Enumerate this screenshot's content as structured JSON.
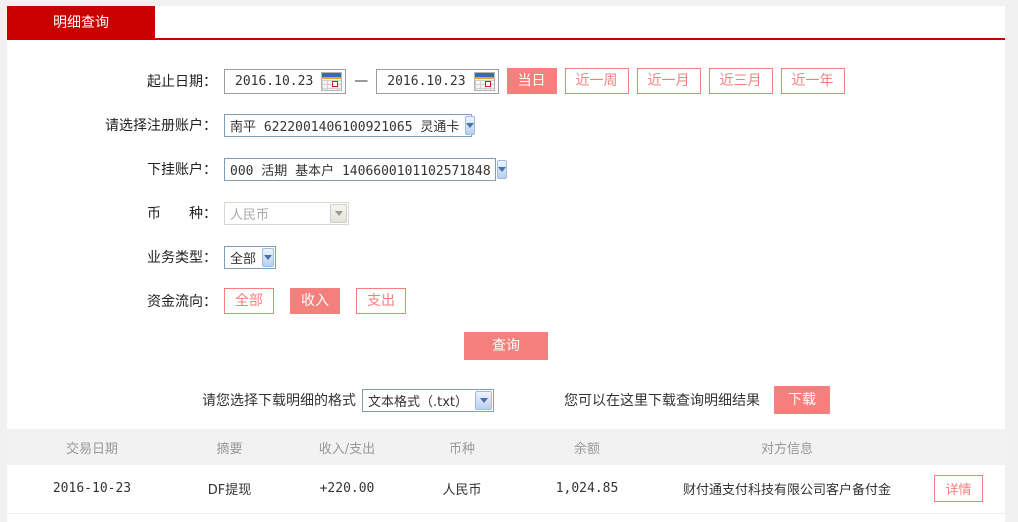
{
  "colors": {
    "brand_red": "#c80000",
    "salmon": "#f4807d",
    "amount_red": "#c00000",
    "page_bg": "#f1f1f1",
    "table_header_bg": "#f2f2f2",
    "select_border": "#7f9db9"
  },
  "tab": {
    "label": "明细查询"
  },
  "form": {
    "date_range": {
      "label": "起止日期：",
      "start": "2016.10.23",
      "separator": "—",
      "end": "2016.10.23"
    },
    "quick_buttons": [
      {
        "label": "当日",
        "active": true
      },
      {
        "label": "近一周",
        "active": false
      },
      {
        "label": "近一月",
        "active": false
      },
      {
        "label": "近三月",
        "active": false
      },
      {
        "label": "近一年",
        "active": false
      }
    ],
    "register_account": {
      "label": "请选择注册账户：",
      "value": "南平 6222001406100921065 灵通卡"
    },
    "sub_account": {
      "label": "下挂账户：",
      "value": "000 活期 基本户 1406600101102571848"
    },
    "currency": {
      "label": "币　　种：",
      "value": "人民币",
      "disabled": true
    },
    "business_type": {
      "label": "业务类型：",
      "value": "全部"
    },
    "fund_flow": {
      "label": "资金流向：",
      "options": [
        {
          "label": "全部",
          "active": false
        },
        {
          "label": "收入",
          "active": true
        },
        {
          "label": "支出",
          "active": false
        }
      ]
    },
    "query_button": "查询"
  },
  "download": {
    "format_label": "请您选择下载明细的格式",
    "format_value": "文本格式（.txt）",
    "hint": "您可以在这里下载查询明细结果",
    "button": "下载"
  },
  "table": {
    "headers": [
      "交易日期",
      "摘要",
      "收入/支出",
      "币种",
      "余额",
      "对方信息"
    ],
    "rows": [
      {
        "date": "2016-10-23",
        "summary": "DF提现",
        "amount": "+220.00",
        "currency": "人民币",
        "balance": "1,024.85",
        "counterpart": "财付通支付科技有限公司客户备付金",
        "detail_label": "详情"
      }
    ]
  }
}
